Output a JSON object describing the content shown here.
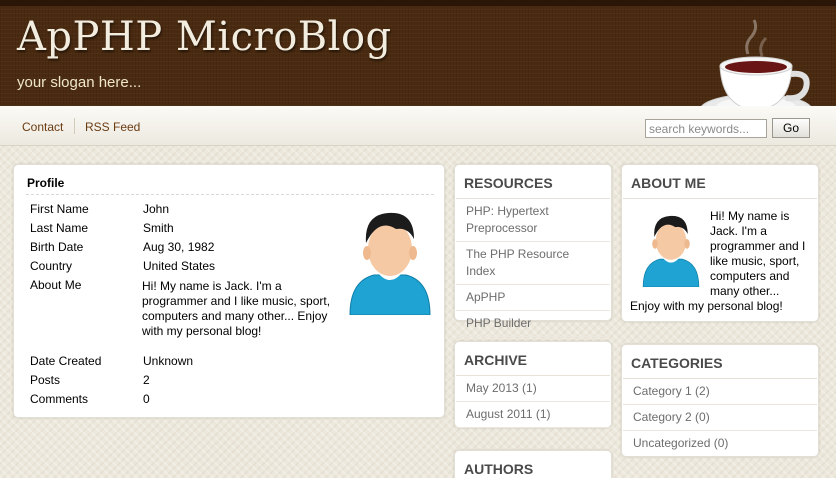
{
  "header": {
    "title": "ApPHP MicroBlog",
    "slogan": "your slogan here..."
  },
  "nav": {
    "contact": "Contact",
    "rss": "RSS Feed"
  },
  "search": {
    "placeholder": "search keywords...",
    "button": "Go"
  },
  "profile": {
    "heading": "Profile",
    "fields": [
      {
        "label": "First Name",
        "value": "John"
      },
      {
        "label": "Last Name",
        "value": "Smith"
      },
      {
        "label": "Birth Date",
        "value": "Aug 30, 1982"
      },
      {
        "label": "Country",
        "value": "United States"
      },
      {
        "label": "About Me",
        "value": "Hi! My name is Jack. I'm a programmer and I like music, sport, computers and many other... Enjoy with my personal blog!"
      },
      {
        "label": "Date Created",
        "value": "Unknown"
      },
      {
        "label": "Posts",
        "value": "2"
      },
      {
        "label": "Comments",
        "value": "0"
      }
    ]
  },
  "resources": {
    "title": "RESOURCES",
    "items": [
      "PHP: Hypertext Preprocessor",
      "The PHP Resource Index",
      "ApPHP",
      "PHP Builder"
    ]
  },
  "archive": {
    "title": "ARCHIVE",
    "items": [
      "May 2013 (1)",
      "August 2011 (1)"
    ]
  },
  "authors": {
    "title": "AUTHORS"
  },
  "about_me": {
    "title": "ABOUT ME",
    "text": "Hi! My name is Jack. I'm a programmer and I like music, sport, computers and many other... Enjoy with my personal blog!"
  },
  "categories": {
    "title": "CATEGORIES",
    "items": [
      "Category 1 (2)",
      "Category 2 (0)",
      "Uncategorized (0)"
    ]
  },
  "icons": {
    "coffee": "coffee-cup-icon",
    "avatar": "user-avatar-icon"
  },
  "colors": {
    "header_bg": "#4a2a10",
    "nav_link": "#6b3b12",
    "page_bg": "#ece8dc"
  }
}
